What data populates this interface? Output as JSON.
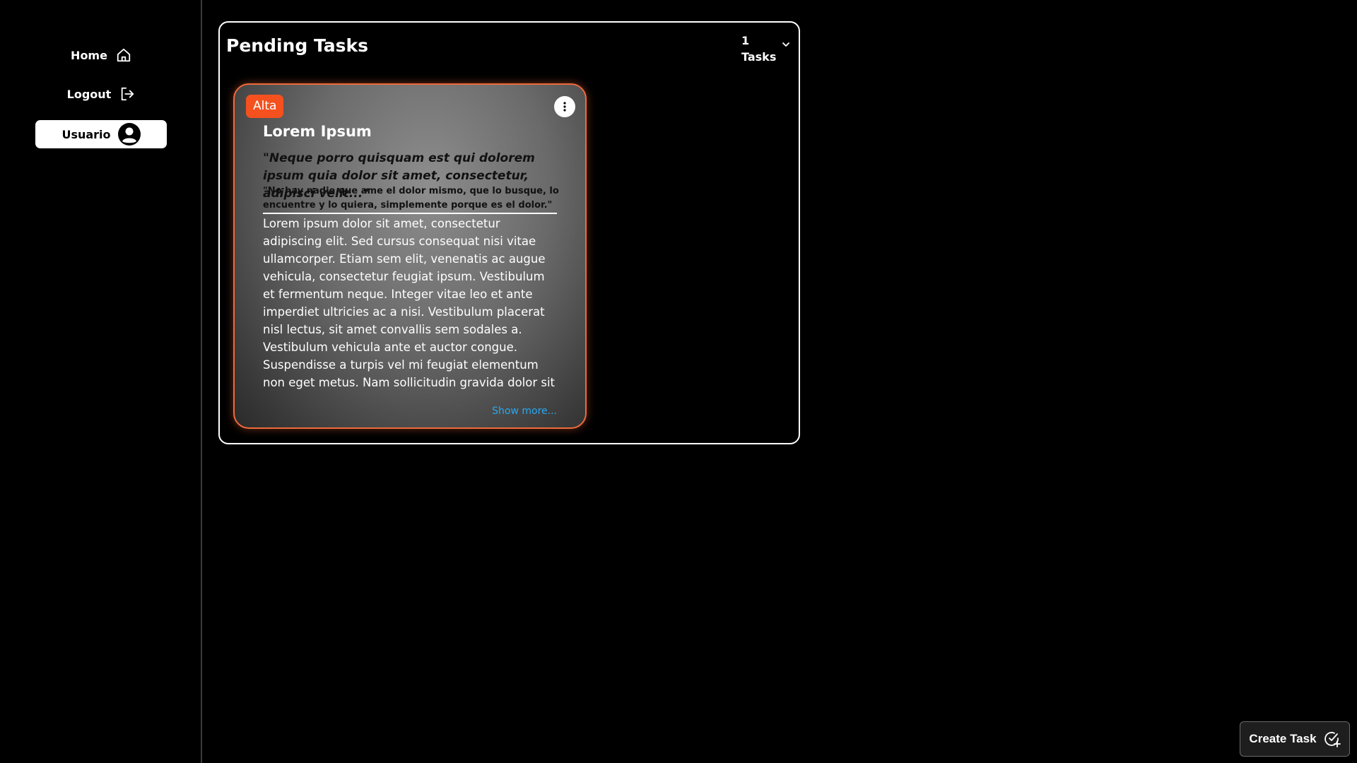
{
  "sidebar": {
    "home_label": "Home",
    "logout_label": "Logout",
    "user_label": "Usuario"
  },
  "panel": {
    "title": "Pending Tasks",
    "count": "1",
    "count_label": "Tasks"
  },
  "task": {
    "priority": "Alta",
    "title": "Lorem Ipsum",
    "quote_main": "\"Neque porro quisquam est qui dolorem ipsum quia dolor sit amet, consectetur, adipisci velit...\"",
    "quote_sub": "\"No hay nadie que ame el dolor mismo, que lo busque, lo encuentre y lo quiera, simplemente porque es el dolor.\"",
    "body": "Lorem ipsum dolor sit amet, consectetur adipiscing elit. Sed cursus consequat nisi vitae ullamcorper. Etiam sem elit, venenatis ac augue vehicula, consectetur feugiat ipsum. Vestibulum et fermentum neque. Integer vitae leo et ante imperdiet ultricies ac a nisi. Vestibulum placerat nisl lectus, sit amet convallis sem sodales a. Vestibulum vehicula ante et auctor congue. Suspendisse a turpis vel mi feugiat elementum non eget metus. Nam sollicitudin gravida dolor sit amet aliquet. Pellentesque porttitor diam nec nisl vulputate",
    "show_more": "Show more..."
  },
  "create_task_label": "Create Task",
  "colors": {
    "accent": "#f4511e",
    "link": "#29a8f0",
    "background": "#000000"
  },
  "icons": {
    "home": "home-icon",
    "logout": "logout-icon",
    "user": "user-circle-icon",
    "menu": "more-vertical-icon",
    "chevron": "chevron-down-icon",
    "create": "add-task-icon"
  }
}
